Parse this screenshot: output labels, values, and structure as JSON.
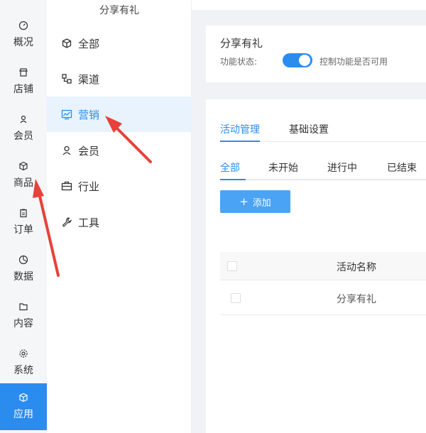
{
  "rail": {
    "items": [
      {
        "label": "概况",
        "icon": "gauge-icon"
      },
      {
        "label": "店铺",
        "icon": "store-icon"
      },
      {
        "label": "会员",
        "icon": "user-icon"
      },
      {
        "label": "商品",
        "icon": "cube-icon"
      },
      {
        "label": "订单",
        "icon": "clipboard-icon"
      },
      {
        "label": "数据",
        "icon": "pie-chart-icon"
      },
      {
        "label": "内容",
        "icon": "folder-icon"
      },
      {
        "label": "系统",
        "icon": "gear-icon"
      },
      {
        "label": "应用",
        "icon": "cube-icon"
      }
    ]
  },
  "submenu": {
    "title": "分享有礼",
    "items": [
      {
        "label": "全部",
        "icon": "cube-icon"
      },
      {
        "label": "渠道",
        "icon": "channel-icon"
      },
      {
        "label": "营销",
        "icon": "trend-chart-icon"
      },
      {
        "label": "会员",
        "icon": "user-icon"
      },
      {
        "label": "行业",
        "icon": "briefcase-icon"
      },
      {
        "label": "工具",
        "icon": "wrench-icon"
      }
    ]
  },
  "feature": {
    "title": "分享有礼",
    "status_label": "功能状态:",
    "hint": "控制功能是否可用"
  },
  "tabs": {
    "activity": "活动管理",
    "basic": "基础设置"
  },
  "filters": {
    "all": "全部",
    "not_started": "未开始",
    "in_progress": "进行中",
    "ended": "已结束"
  },
  "add_button": {
    "plus": "+",
    "label": "添加"
  },
  "table": {
    "column_name": "活动名称",
    "rows": [
      {
        "name": "分享有礼"
      }
    ]
  },
  "colors": {
    "accent": "#2b8cf0",
    "arrow": "#e8413a"
  }
}
